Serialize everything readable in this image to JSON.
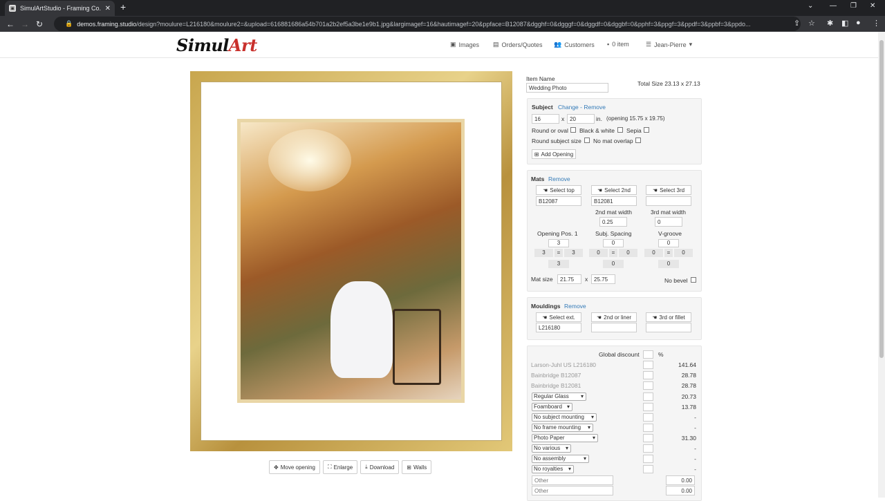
{
  "browser": {
    "tab_title": "SimulArtStudio - Framing Co.",
    "url_host": "demos.framing.studio",
    "url_path": "/design?moulure=L216180&moulure2=&upload=616881686a54b701a2b2ef5a3be1e9b1.jpg&largimagef=16&hautimagef=20&ppface=B12087&dgghf=0&dgggf=0&dggdf=0&dggbf=0&pphf=3&ppgf=3&ppdf=3&ppbf=3&ppdo..."
  },
  "app": {
    "logo_simul": "Simul",
    "logo_art": "Art"
  },
  "nav": {
    "images": "Images",
    "orders": "Orders/Quotes",
    "customers": "Customers",
    "cart": "0 item",
    "user": "Jean-Pierre"
  },
  "preview_buttons": {
    "move": "Move opening",
    "enlarge": "Enlarge",
    "download": "Download",
    "walls": "Walls"
  },
  "item": {
    "name_label": "Item Name",
    "name_value": "Wedding Photo",
    "total_size": "Total Size 23.13 x 27.13"
  },
  "subject": {
    "title": "Subject",
    "change_remove": "Change - Remove",
    "width": "16",
    "x": "x",
    "height": "20",
    "unit": "in.",
    "opening": "(opening 15.75 x 19.75)",
    "round_oval": "Round or oval",
    "bw": "Black & white",
    "sepia": "Sepia",
    "round_size": "Round subject size",
    "no_overlap": "No mat overlap",
    "add_opening": "Add Opening"
  },
  "mats": {
    "title": "Mats",
    "remove": "Remove",
    "select_top": "Select top",
    "select_2nd": "Select 2nd",
    "select_3rd": "Select 3rd",
    "top_code": "B12087",
    "second_code": "B12081",
    "w2_label": "2nd mat width",
    "w2": "0.25",
    "w3_label": "3rd mat width",
    "w3": "0",
    "op_label": "Opening Pos. 1",
    "sp_label": "Subj. Spacing",
    "vg_label": "V-groove",
    "op": {
      "t": "3",
      "l": "3",
      "eq": "=",
      "r": "3",
      "b": "3"
    },
    "sp": {
      "t": "0",
      "l": "0",
      "eq": "=",
      "r": "0",
      "b": "0"
    },
    "vg": {
      "t": "0",
      "l": "0",
      "eq": "=",
      "r": "0",
      "b": "0"
    },
    "size_label": "Mat size",
    "size_w": "21.75",
    "size_x": "x",
    "size_h": "25.75",
    "no_bevel": "No bevel"
  },
  "mouldings": {
    "title": "Mouldings",
    "remove": "Remove",
    "select_ext": "Select ext.",
    "select_liner": "2nd or liner",
    "select_fillet": "3rd or fillet",
    "ext_code": "L216180"
  },
  "pricing": {
    "global_discount": "Global discount",
    "pct": "%",
    "lines": [
      {
        "label": "Larson-Juhl US L216180",
        "price": "141.64"
      },
      {
        "label": "Bainbridge B12087",
        "price": "28.78"
      },
      {
        "label": "Bainbridge B12081",
        "price": "28.78"
      }
    ],
    "selects": [
      {
        "label": "Regular Glass",
        "price": "20.73"
      },
      {
        "label": "Foamboard",
        "price": "13.78"
      },
      {
        "label": "No subject mounting",
        "price": "-"
      },
      {
        "label": "No frame mounting",
        "price": "-"
      },
      {
        "label": "Photo Paper",
        "price": "31.30"
      },
      {
        "label": "No various",
        "price": "-"
      },
      {
        "label": "No assembly",
        "price": "-"
      },
      {
        "label": "No royalties",
        "price": "-"
      }
    ],
    "other": [
      {
        "placeholder": "Other",
        "value": "0.00"
      },
      {
        "placeholder": "Other",
        "value": "0.00"
      }
    ]
  }
}
